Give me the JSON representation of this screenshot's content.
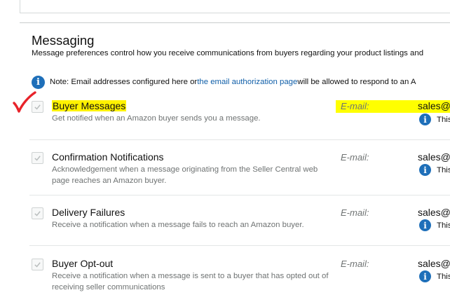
{
  "section": {
    "title": "Messaging",
    "subtitle": "Message preferences control how you receive communications from buyers regarding your product listings and"
  },
  "note": {
    "prefix": "Note: Email addresses configured here or ",
    "link": "the email authorization page",
    "suffix": " will be allowed to respond to an A"
  },
  "icons": {
    "info": "info-icon",
    "check": "check-icon",
    "annotation": "red-checkmark-annotation-icon"
  },
  "colors": {
    "highlight": "#fff200",
    "info_blue": "#1e6fb9",
    "link_blue": "#0f5ea8",
    "annotation_red": "#e8232a"
  },
  "preferences": [
    {
      "label": "Buyer Messages",
      "description": "Get notified when an Amazon buyer sends you a message.",
      "email_label": "E-mail:",
      "email": "sales@",
      "status_text": "This",
      "highlighted": true,
      "checked": true
    },
    {
      "label": "Confirmation Notifications",
      "description": "Acknowledgement when a message originating from the Seller Central web page reaches an Amazon buyer.",
      "email_label": "E-mail:",
      "email": "sales@",
      "status_text": "This",
      "checked": true
    },
    {
      "label": "Delivery Failures",
      "description": "Receive a notification when a message fails to reach an Amazon buyer.",
      "email_label": "E-mail:",
      "email": "sales@",
      "status_text": "This",
      "checked": true
    },
    {
      "label": "Buyer Opt-out",
      "description": "Receive a notification when a message is sent to a buyer that has opted out of receiving seller communications",
      "email_label": "E-mail:",
      "email": "sales@",
      "status_text": "This",
      "checked": true
    }
  ]
}
